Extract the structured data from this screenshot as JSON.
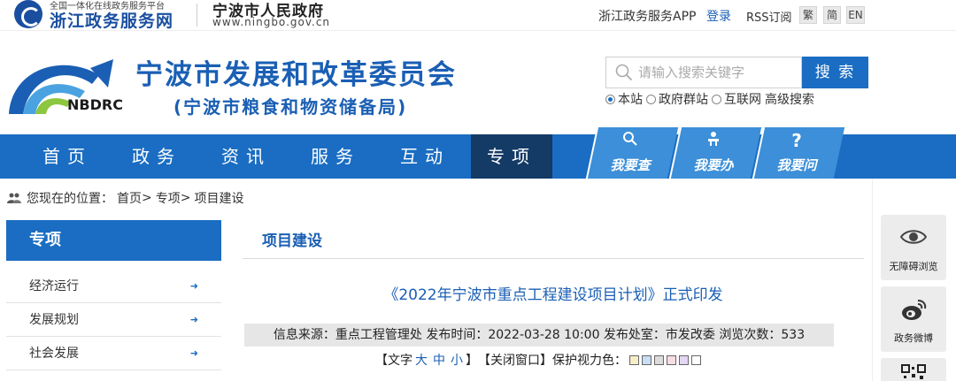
{
  "topbar": {
    "zj_platform_sub": "全国一体化在线政务服务平台",
    "zj_platform_name": "浙江政务服务网",
    "gov_name": "宁波市人民政府",
    "gov_url": "www.ningbo.gov.cn",
    "app_link": "浙江政务服务APP",
    "login": "登录",
    "rss": "RSS订阅",
    "lang_traditional": "繁",
    "lang_simplified": "简",
    "lang_english": "EN"
  },
  "header": {
    "logo_text": "NBDRC",
    "title": "宁波市发展和改革委员会",
    "subtitle": "(宁波市粮食和物资储备局)",
    "search_placeholder": "请输入搜索关键字",
    "search_button": "搜 索",
    "scope_options": [
      "本站",
      "政府群站",
      "互联网"
    ],
    "scope_selected": "本站",
    "advanced_search": "高级搜索"
  },
  "nav": {
    "items": [
      "首页",
      "政务",
      "资讯",
      "服务",
      "互动",
      "专项"
    ],
    "active": "专项",
    "quick_links": [
      "我要查",
      "我要办",
      "我要问"
    ]
  },
  "breadcrumb": {
    "prefix": "您现在的位置：",
    "home": "首页",
    "level1": "专项",
    "level2": "项目建设",
    "sep": ">"
  },
  "sidebar": {
    "heading": "专项",
    "items": [
      "经济运行",
      "发展规划",
      "社会发展"
    ]
  },
  "article": {
    "section_title": "项目建设",
    "title": "《2022年宁波市重点工程建设项目计划》正式印发",
    "meta": "信息来源：重点工程管理处 发布时间：2022-03-28 10:00 发布处室：市发改委 浏览次数：533",
    "text_size_label": "【文字",
    "size_large": "大",
    "size_medium": "中",
    "size_small": "小",
    "text_size_end": "】",
    "close_window": "【关闭窗口】",
    "eye_care_label": "保护视力色：",
    "eye_care_colors": [
      "#f6eec8",
      "#c8def4",
      "#dcdcdc",
      "#f7dde4",
      "#e4d6f4",
      "#ffffff"
    ]
  },
  "right_widgets": {
    "accessibility": "无障碍浏览",
    "weibo": "政务微博"
  },
  "colors": {
    "brand_blue": "#1a6dc2",
    "nav_active": "#143a66",
    "title_blue": "#1a5fb4"
  }
}
